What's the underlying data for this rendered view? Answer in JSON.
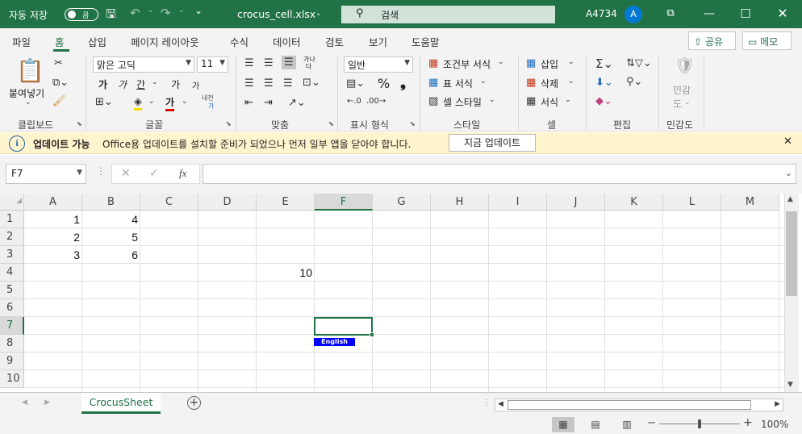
{
  "titlebar": {
    "autosave_label": "자동 저장",
    "autosave_state": "끔",
    "filename": "crocus_cell.xlsx",
    "search_placeholder": "검색",
    "user_name": "A4734",
    "user_initial": "A",
    "quick_access_dropdown": "⌄"
  },
  "ribbon_tabs": [
    "파일",
    "홈",
    "삽입",
    "페이지 레이아웃",
    "수식",
    "데이터",
    "검토",
    "보기",
    "도움말"
  ],
  "ribbon_tab_active": "홈",
  "top_buttons": {
    "share": "공유",
    "comments": "메모"
  },
  "ribbon": {
    "clipboard": {
      "paste": "붙여넣기",
      "label": "클립보드"
    },
    "font": {
      "name": "맑은 고딕",
      "size": "11",
      "label": "글꼴",
      "bold": "가",
      "italic": "가",
      "underline": "간",
      "grow": "가",
      "shrink": "가",
      "color": "가",
      "phonetic_top": "내천",
      "phonetic_bottom": "가"
    },
    "alignment": {
      "wrap_top": "가나",
      "wrap_bottom": "다",
      "label": "맞춤"
    },
    "number": {
      "format": "일반",
      "percent": "%",
      "comma": "❟",
      "label": "표시 형식"
    },
    "styles": {
      "conditional": "조건부 서식",
      "table": "표 서식",
      "cell_styles": "셀 스타일",
      "label": "스타일"
    },
    "cells": {
      "insert": "삽입",
      "delete": "삭제",
      "format": "서식",
      "label": "셀"
    },
    "editing": {
      "label": "편집"
    },
    "sensitivity": {
      "label_top": "민감",
      "label_bottom": "도",
      "label": "민감도"
    }
  },
  "infobar": {
    "title": "업데이트 가능",
    "message": "Office용 업데이트를 설치할 준비가 되었으나 먼저 일부 앱을 닫아야 합니다.",
    "button": "지금 업데이트"
  },
  "formula_bar": {
    "name_box": "F7",
    "fx": "fx",
    "formula": ""
  },
  "grid": {
    "columns": [
      "A",
      "B",
      "C",
      "D",
      "E",
      "F",
      "G",
      "H",
      "I",
      "J",
      "K",
      "L",
      "M"
    ],
    "rows": [
      "1",
      "2",
      "3",
      "4",
      "5",
      "6",
      "7",
      "8",
      "9",
      "10"
    ],
    "selected_column": "F",
    "selected_row": "7",
    "cells": {
      "A1": "1",
      "B1": "4",
      "A2": "2",
      "B2": "5",
      "A3": "3",
      "B3": "6",
      "E4": "10"
    },
    "ime_indicator": "English"
  },
  "sheets": {
    "active": "CrocusSheet",
    "add": "+"
  },
  "statusbar": {
    "zoom": "100%",
    "zoom_minus": "−",
    "zoom_plus": "+"
  },
  "colors": {
    "excel_green": "#217346",
    "ime_blue": "#0000ff",
    "info_yellow": "#fff4ce"
  }
}
